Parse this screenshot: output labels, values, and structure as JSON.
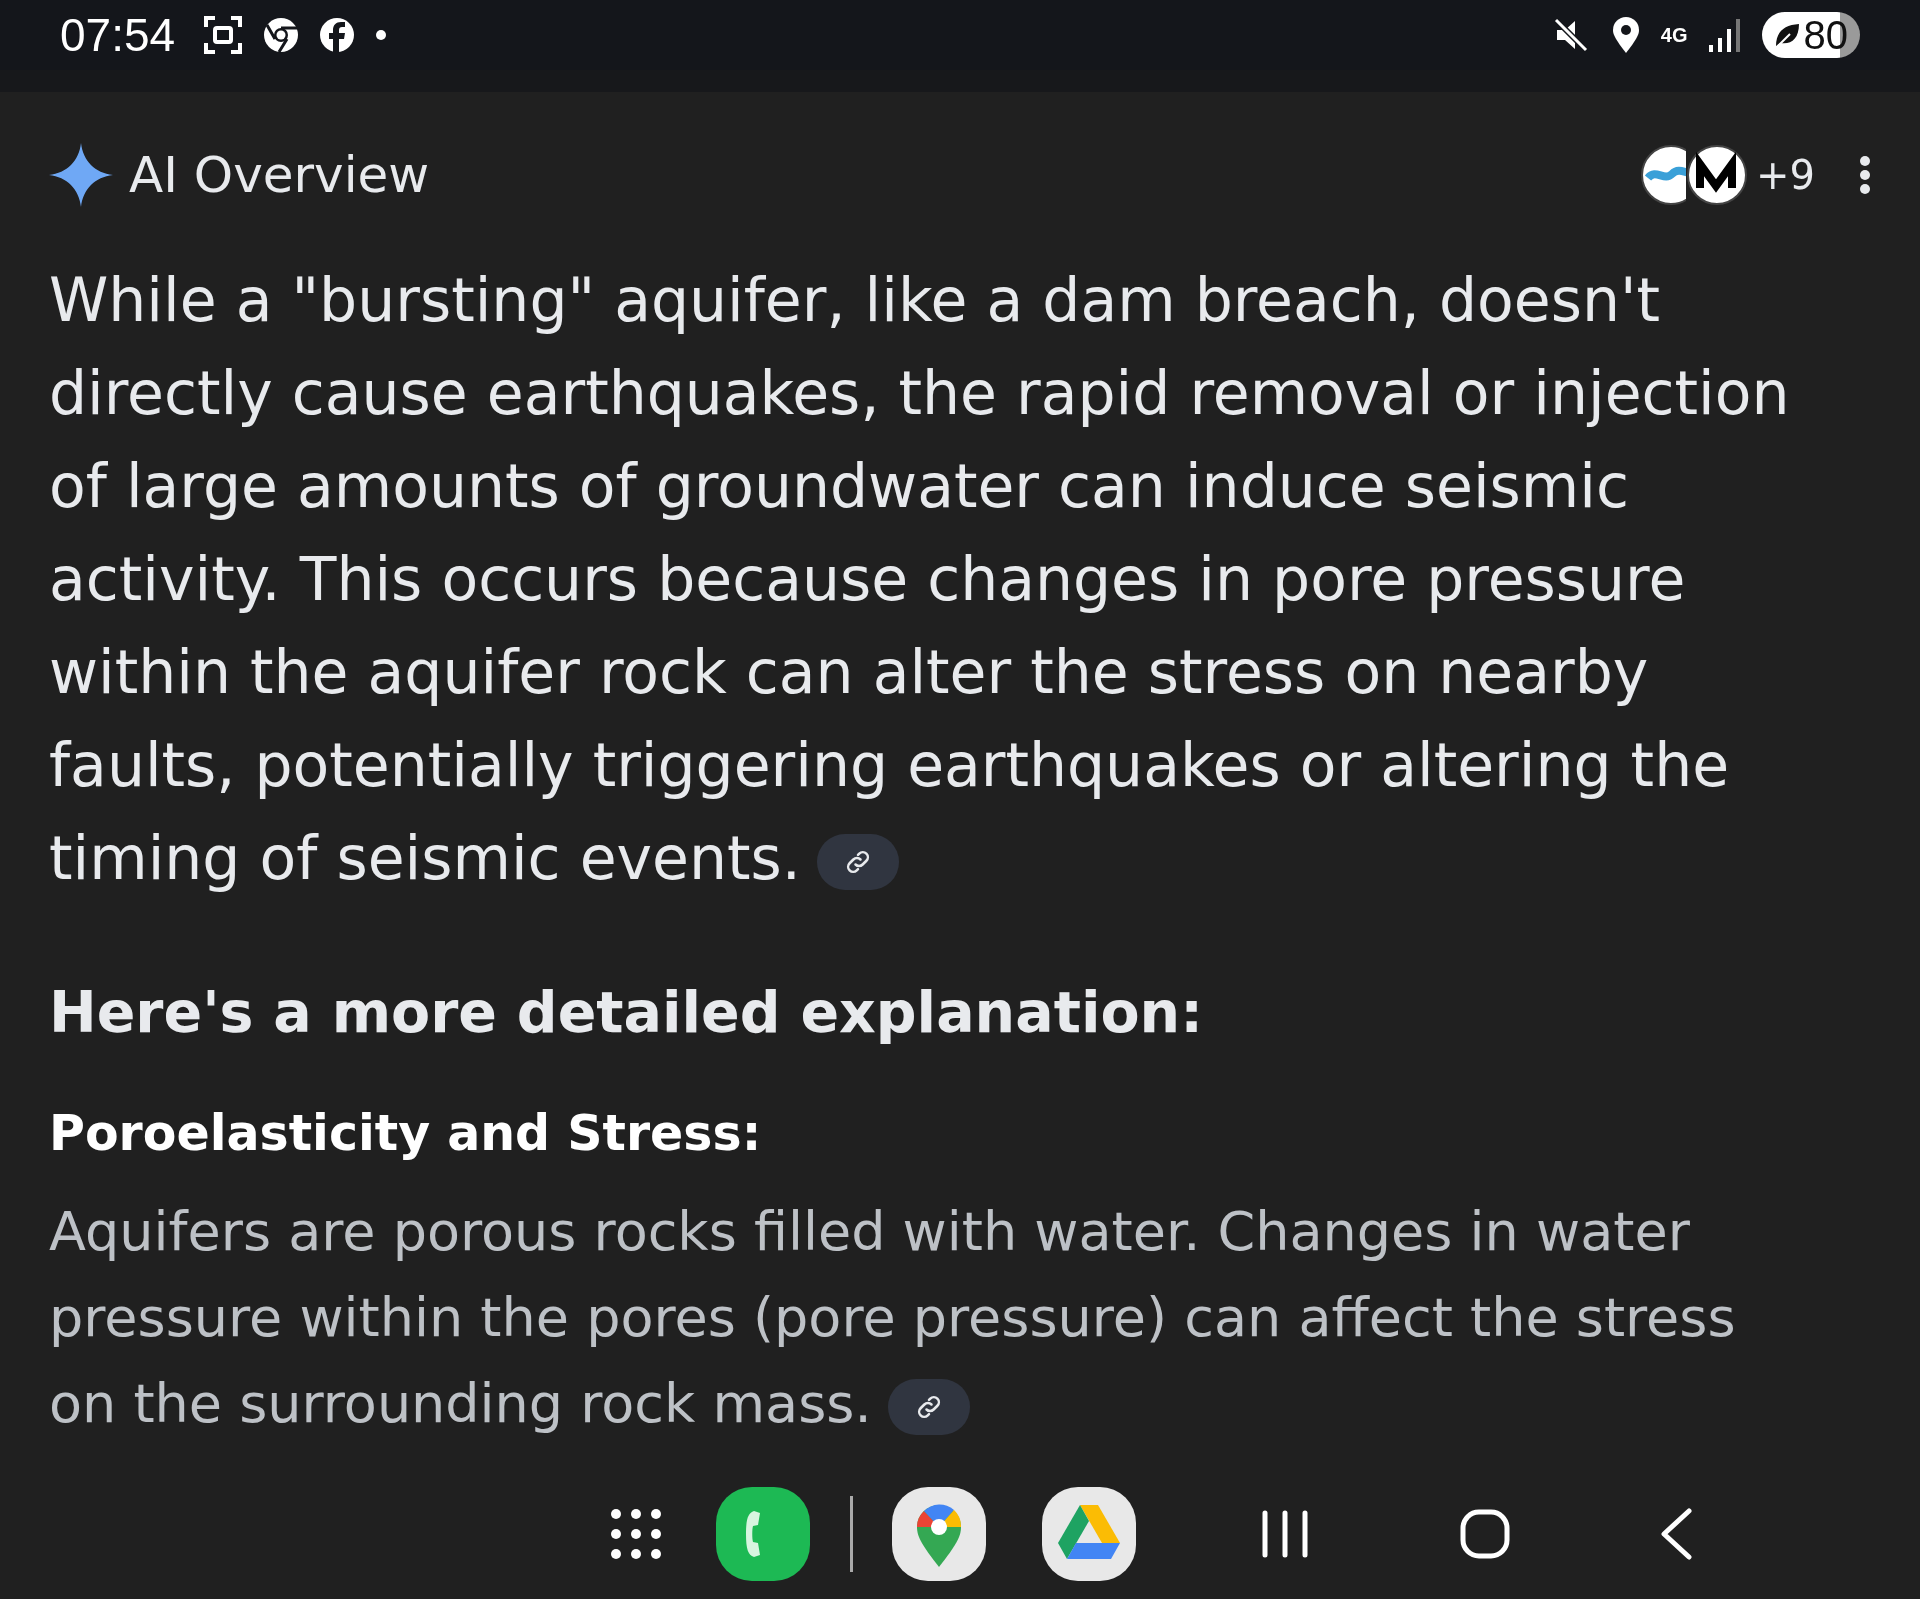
{
  "status_bar": {
    "time": "07:54",
    "network": "4G",
    "battery": "80"
  },
  "overview": {
    "title": "AI Overview",
    "sources_more": "+9",
    "summary": "While a \"bursting\" aquifer, like a dam breach, doesn't directly cause earthquakes, the rapid removal or injection of large amounts of groundwater can induce seismic activity. This occurs because changes in pore pressure within the aquifer rock can alter the stress on nearby faults, potentially triggering earthquakes or altering the timing of seismic events.",
    "heading": "Here's a more detailed explanation:",
    "sections": [
      {
        "title": "Poroelasticity and Stress:",
        "text": "Aquifers are porous rocks filled with water. Changes in water pressure within the pores (pore pressure) can affect the stress on the surrounding rock mass."
      }
    ]
  }
}
